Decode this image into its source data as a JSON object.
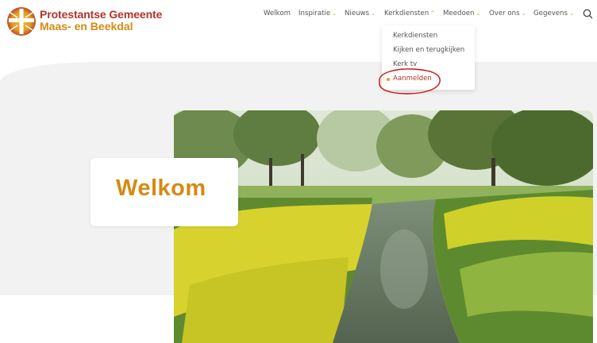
{
  "site": {
    "name_line1": "Protestantse Gemeente",
    "name_line2": "Maas- en Beekdal"
  },
  "nav": {
    "items": [
      {
        "label": "Welkom",
        "chevron": ""
      },
      {
        "label": "Inspiratie",
        "chevron": "⌄"
      },
      {
        "label": "Nieuws",
        "chevron": "⌄"
      },
      {
        "label": "Kerkdiensten",
        "chevron": "^"
      },
      {
        "label": "Meedoen",
        "chevron": "⌄"
      },
      {
        "label": "Over ons",
        "chevron": "⌄"
      },
      {
        "label": "Gegevens",
        "chevron": "⌄"
      }
    ],
    "search_icon": "search-icon"
  },
  "dropdown": {
    "items": [
      {
        "label": "Kerkdiensten"
      },
      {
        "label": "Kijken en terugkijken"
      },
      {
        "label": "Kerk tv"
      },
      {
        "label": "Aanmelden"
      }
    ]
  },
  "hero": {
    "title": "Welkom"
  },
  "colors": {
    "brand_red": "#b1342a",
    "brand_orange": "#d58a14",
    "accent": "#e39b24",
    "annotation": "#cc1111",
    "background_gray": "#f2f2f2"
  }
}
